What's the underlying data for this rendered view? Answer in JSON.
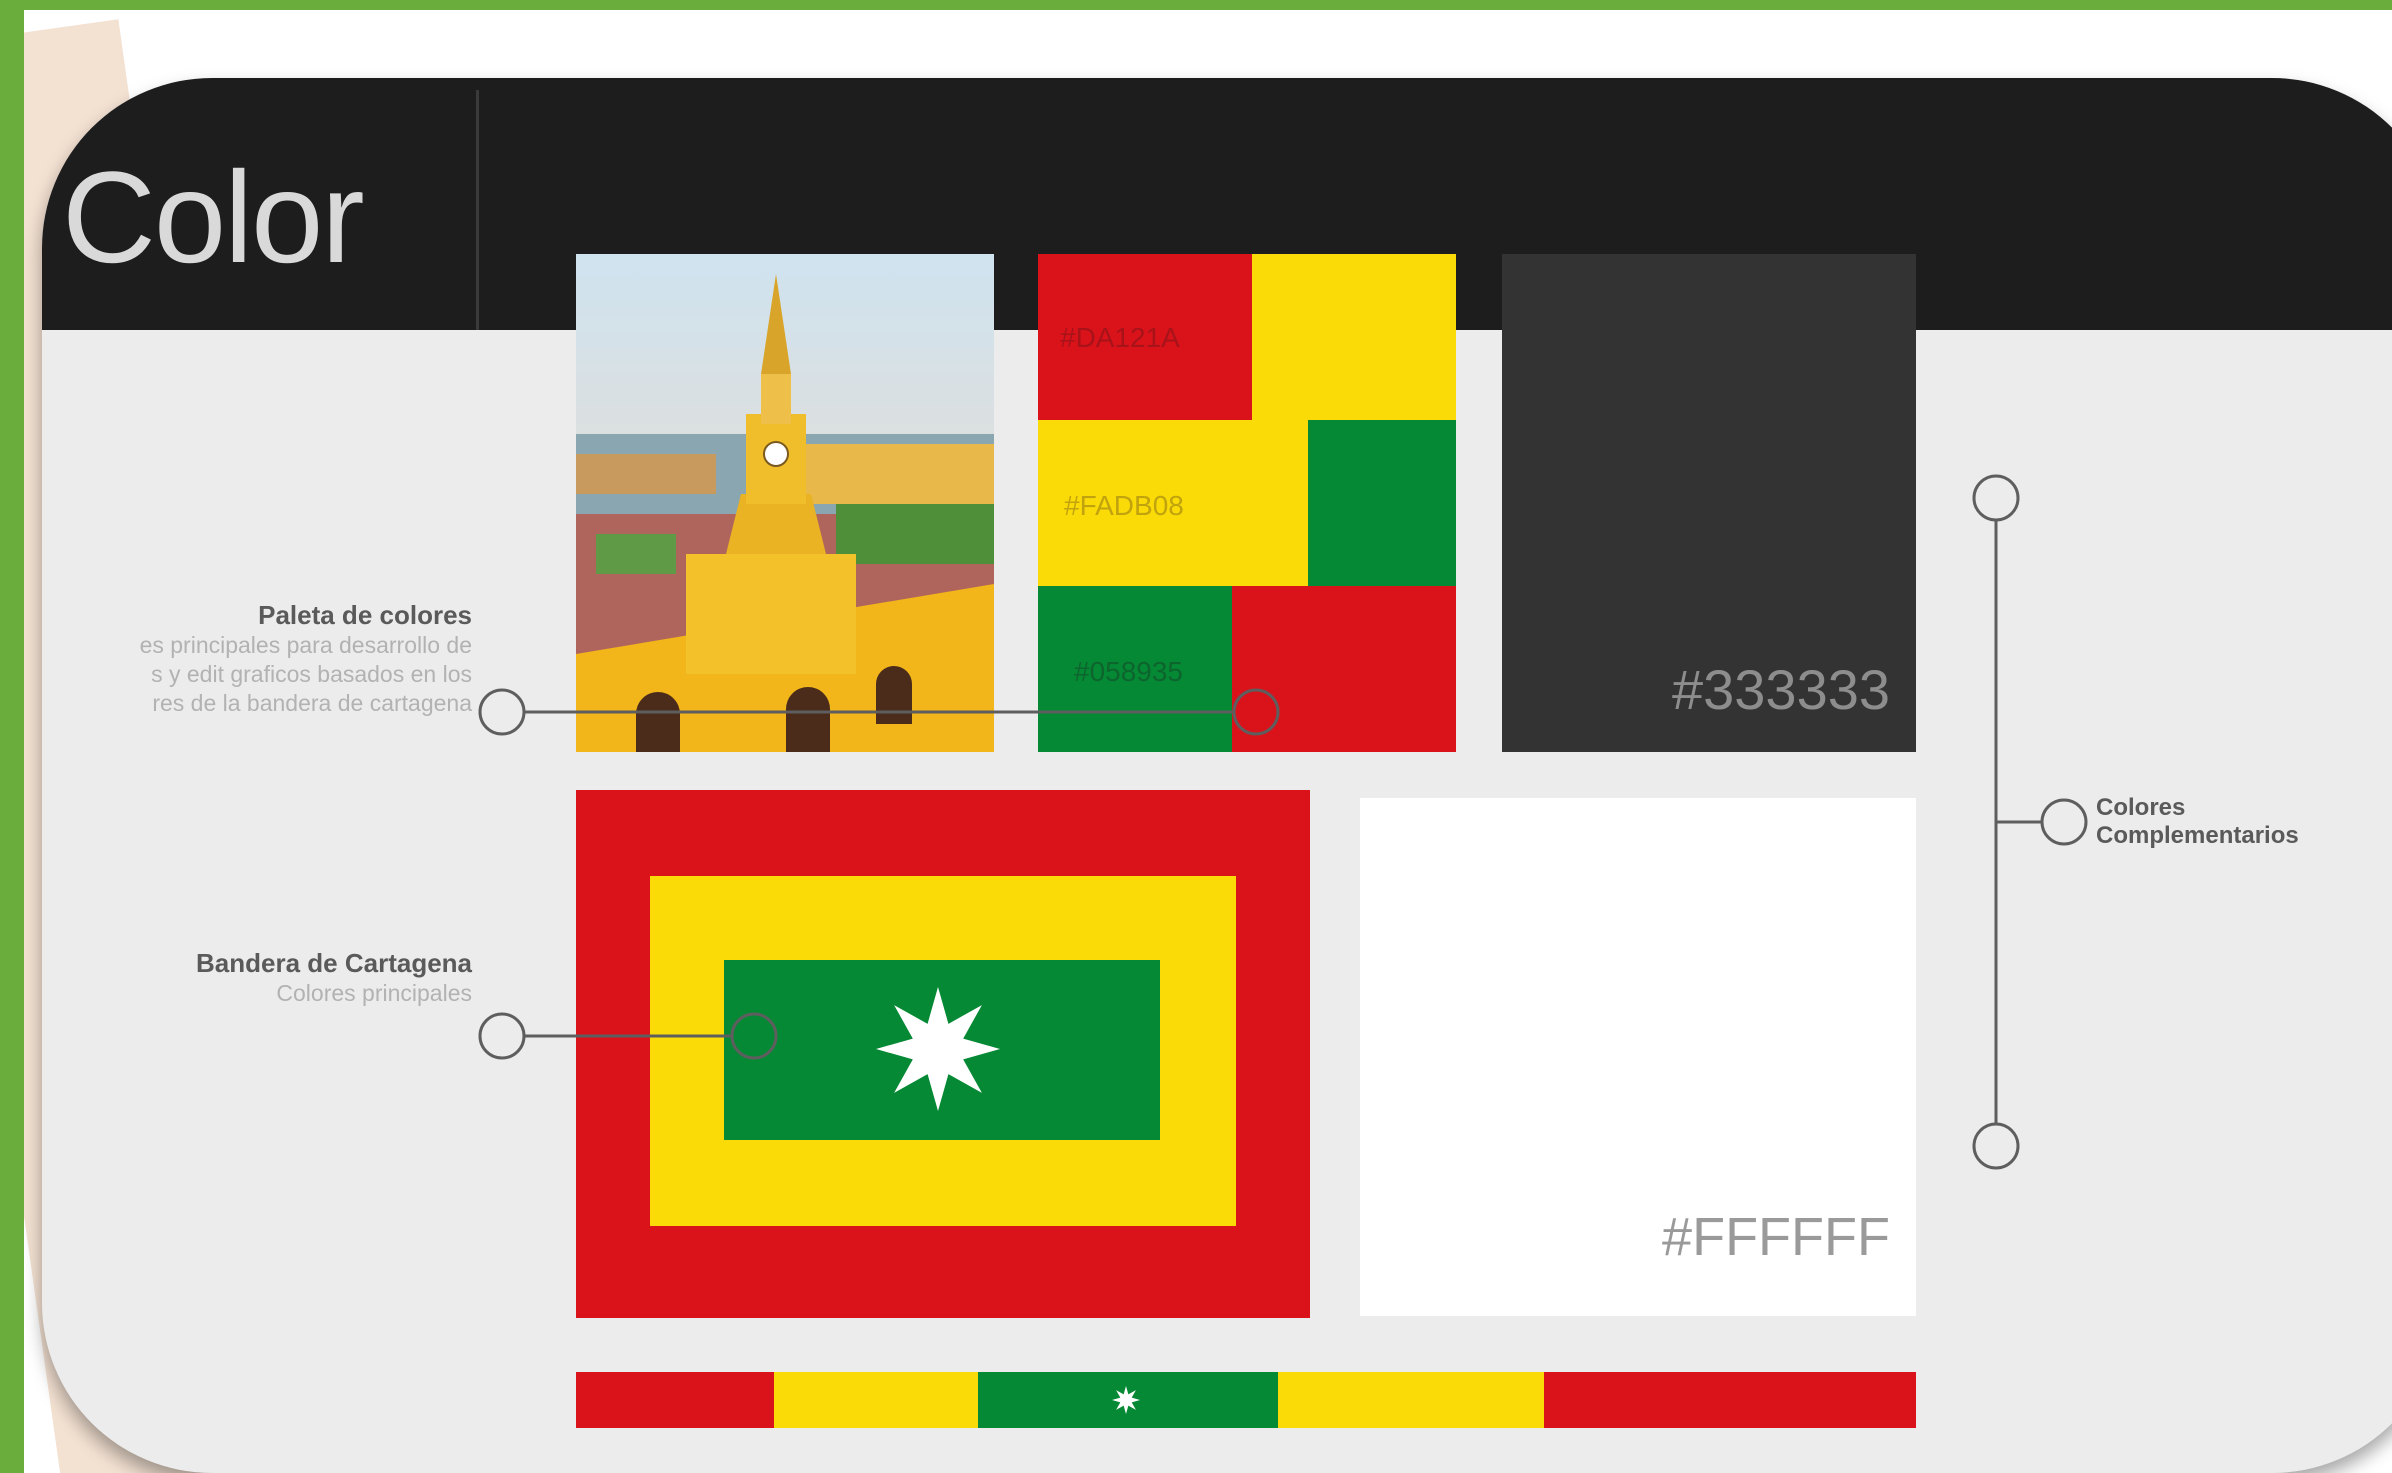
{
  "slide": {
    "title": "Color"
  },
  "palette": {
    "primary": [
      {
        "hex": "#DA121A",
        "label": "#DA121A"
      },
      {
        "hex": "#FADB08",
        "label": "#FADB08"
      },
      {
        "hex": "#058935",
        "label": "#058935"
      }
    ]
  },
  "complementary": {
    "dark": {
      "hex": "#333333",
      "label": "#333333"
    },
    "light": {
      "hex": "#FFFFFF",
      "label": "#FFFFFF"
    }
  },
  "annotations": {
    "palette_title": "Paleta de colores",
    "palette_desc_1": "es principales para desarrollo de",
    "palette_desc_2": "s y edit graficos basados en los",
    "palette_desc_3": "res de la bandera de cartagena",
    "flag_title": "Bandera de Cartagena",
    "flag_desc": "Colores principales",
    "complementary_title_1": "Colores",
    "complementary_title_2": "Complementarios"
  }
}
